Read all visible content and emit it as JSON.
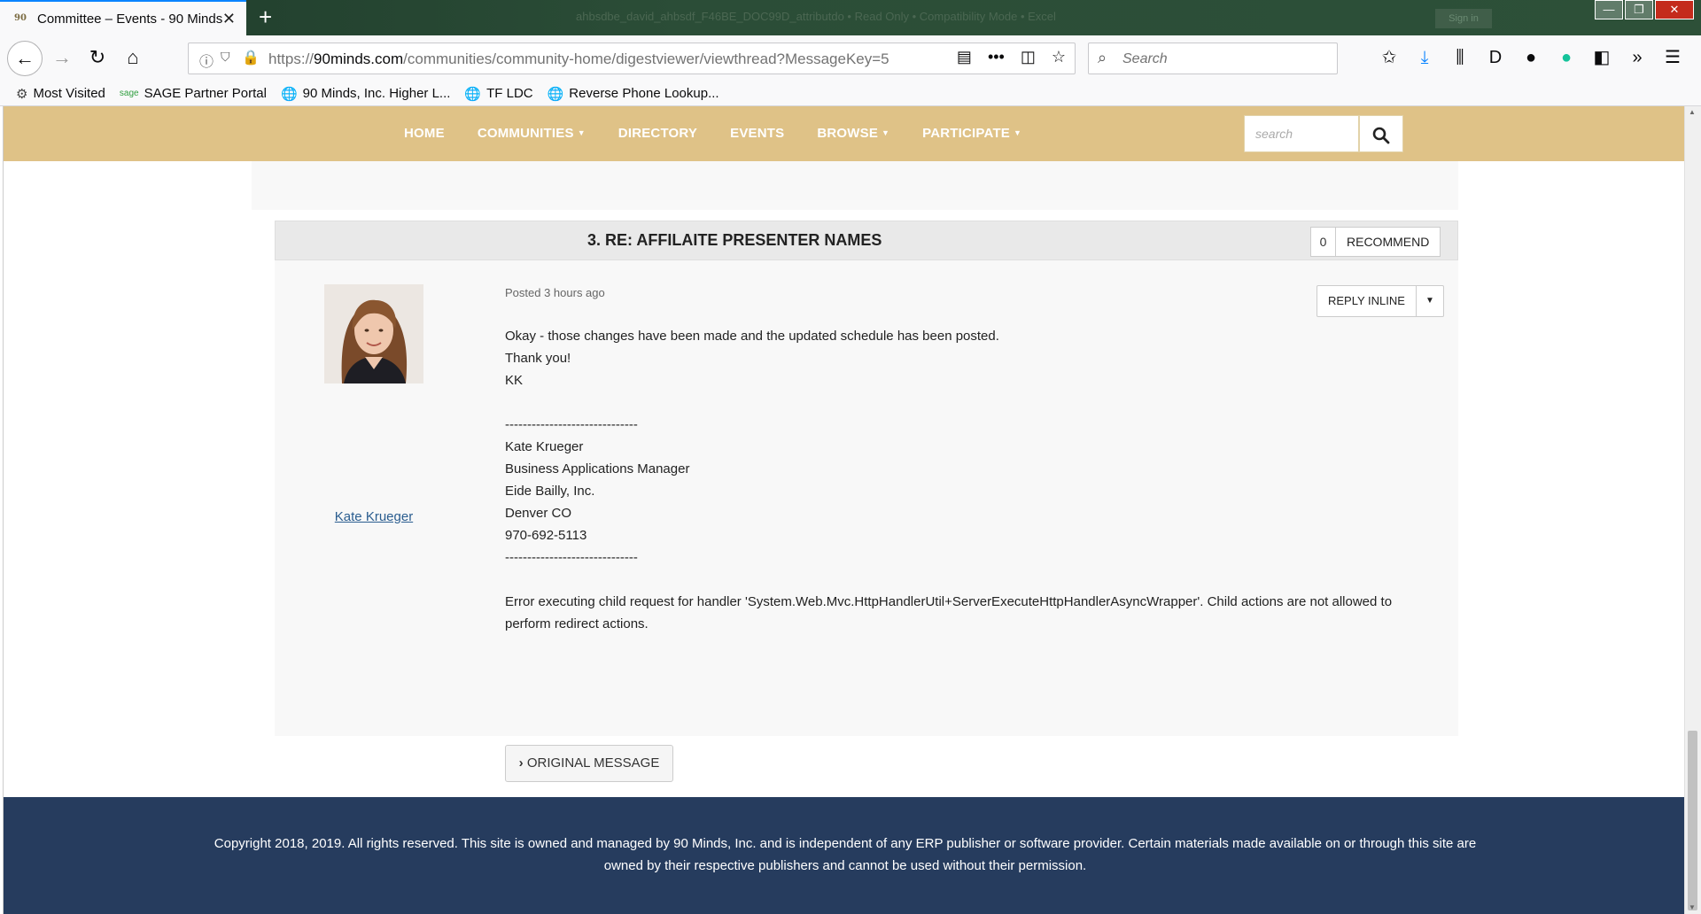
{
  "browser": {
    "tab_title": "Committee – Events - 90 Minds",
    "tab_favicon": "90",
    "faded_title": "ahbsdbe_david_ahbsdf_F46BE_DOC99D_attributdo  •  Read Only  •  Compatibility Mode  •  Excel",
    "faded_signin": "Sign in",
    "url_scheme": "https://",
    "url_domain": "90minds.com",
    "url_path": "/communities/community-home/digestviewer/viewthread?MessageKey=5",
    "search_placeholder": "Search",
    "bookmarks": [
      {
        "label": "Most Visited",
        "icon": "gear-icon"
      },
      {
        "label": "SAGE Partner Portal",
        "icon": "sage-icon"
      },
      {
        "label": "90 Minds, Inc. Higher L...",
        "icon": "globe-icon"
      },
      {
        "label": "TF LDC",
        "icon": "globe-icon"
      },
      {
        "label": "Reverse Phone Lookup...",
        "icon": "globe-icon"
      }
    ]
  },
  "site": {
    "nav": {
      "home": "HOME",
      "communities": "COMMUNITIES",
      "directory": "DIRECTORY",
      "events": "EVENTS",
      "browse": "BROWSE",
      "participate": "PARTICIPATE"
    },
    "search_placeholder": "search"
  },
  "message": {
    "title": "3. RE: AFFILAITE PRESENTER NAMES",
    "recommend_count": "0",
    "recommend_label": "RECOMMEND",
    "posted": "Posted 3 hours ago",
    "reply_label": "REPLY INLINE",
    "author": "Kate Krueger",
    "body_lines": [
      "Okay - those changes have been made and the updated schedule has been posted.",
      "Thank you!",
      "KK"
    ],
    "separator": "------------------------------",
    "signature": [
      "Kate Krueger",
      "Business Applications Manager",
      "Eide Bailly, Inc.",
      "Denver CO",
      "970-692-5113"
    ],
    "error_text": "Error executing child request for handler 'System.Web.Mvc.HttpHandlerUtil+ServerExecuteHttpHandlerAsyncWrapper'. Child actions are not allowed to perform redirect actions.",
    "original_message_label": "ORIGINAL MESSAGE"
  },
  "footer": {
    "text": "Copyright 2018, 2019. All rights reserved. This site is owned and managed by 90 Minds, Inc. and is independent of any ERP publisher or software provider. Certain materials made available on or through this site are owned by their respective publishers and cannot be used without their permission."
  },
  "colors": {
    "nav_gold": "#dfc287",
    "footer_navy": "#263c5e",
    "link_blue": "#2a5d8f"
  }
}
